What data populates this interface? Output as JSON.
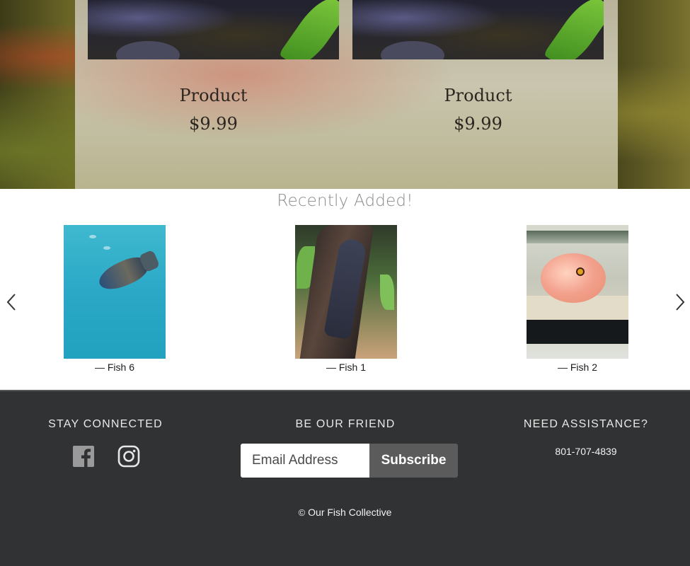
{
  "products": [
    {
      "name": "Product",
      "price": "$9.99"
    },
    {
      "name": "Product",
      "price": "$9.99"
    }
  ],
  "recent": {
    "title": "Recently Added!",
    "items": [
      {
        "caption": "— Fish 6"
      },
      {
        "caption": "— Fish 1"
      },
      {
        "caption": "— Fish 2"
      }
    ],
    "prev_icon": "chevron-left-icon",
    "next_icon": "chevron-right-icon"
  },
  "footer": {
    "stay_connected": "STAY CONNECTED",
    "be_our_friend": "BE OUR FRIEND",
    "need_assistance": "NEED ASSISTANCE?",
    "email_placeholder": "Email Address",
    "subscribe_label": "Subscribe",
    "phone": "801-707-4839",
    "copyright_symbol": "©",
    "copyright_text": "Our Fish Collective",
    "social_icons": [
      "facebook-icon",
      "instagram-icon"
    ]
  },
  "colors": {
    "footer_bg": "#313233",
    "subscribe_bg": "#5b5b5c",
    "title_gray": "#8a8a8a"
  }
}
